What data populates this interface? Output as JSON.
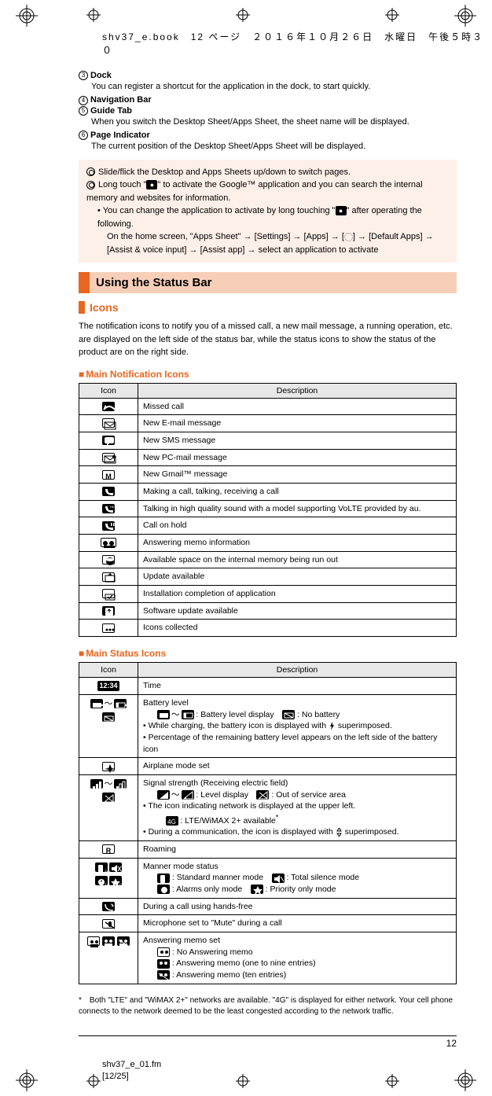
{
  "header": "shv37_e.book　12 ページ　２０１６年１０月２６日　水曜日　午後５時３０",
  "items": [
    {
      "num": "3",
      "title": "Dock",
      "desc": "You can register a shortcut for the application in the dock, to start quickly."
    },
    {
      "num": "4",
      "title": "Navigation Bar",
      "desc": ""
    },
    {
      "num": "5",
      "title": "Guide Tab",
      "desc": "When you switch the Desktop Sheet/Apps Sheet, the sheet name will be displayed."
    },
    {
      "num": "6",
      "title": "Page Indicator",
      "desc": "The current position of the Desktop Sheet/Apps Sheet will be displayed."
    }
  ],
  "note": {
    "l1": "Slide/flick the Desktop and Apps Sheets up/down to switch pages.",
    "l2a": "Long touch \"",
    "l2b": "\" to activate the Google™ application and you can search the internal memory and websites for information.",
    "s1a": "You can change the application to activate by long touching \"",
    "s1b": "\" after operating the following.",
    "s2": "On the home screen, \"Apps Sheet\" → [Settings] → [Apps] → [",
    "s2b": "] → [Default Apps] → [Assist & voice input] → [Assist app] → select an application to activate"
  },
  "section_title": "Using the Status Bar",
  "subsection_title": "Icons",
  "intro": "The notification icons to notify you of a missed call, a new mail message, a running operation, etc. are displayed on the left side of the status bar, while the status icons to show the status of the product are on the right side.",
  "table_headers": {
    "icon": "Icon",
    "desc": "Description"
  },
  "notif_heading": "Main Notification Icons",
  "notif_rows": [
    "Missed call",
    "New E-mail message",
    "New SMS message",
    "New PC-mail message",
    "New Gmail™ message",
    "Making a call, talking, receiving a call",
    "Talking in high quality sound with a model supporting VoLTE provided by au.",
    "Call on hold",
    "Answering memo information",
    "Available space on the internal memory being run out",
    "Update available",
    "Installation completion of application",
    "Software update available",
    "Icons collected"
  ],
  "status_heading": "Main Status Icons",
  "status": {
    "time_label": "12:34",
    "time": "Time",
    "battery": {
      "title": "Battery level",
      "l1": " : Battery level display　",
      "l1b": " : No battery",
      "l2": "While charging, the battery icon is displayed with ",
      "l2b": " superimposed.",
      "l3": "Percentage of the remaining battery level appears on the left side of the battery icon"
    },
    "airplane": "Airplane mode set",
    "signal": {
      "title": "Signal strength (Receiving electric field)",
      "l1": " : Level display　",
      "l1b": " : Out of service area",
      "l2": "The icon indicating network is displayed at the upper left.",
      "l2sub": " : LTE/WiMAX 2+ available",
      "l3": "During a communication, the icon is displayed with ",
      "l3b": " superimposed."
    },
    "roaming": "Roaming",
    "manner": {
      "title": "Manner mode status",
      "m1": " : Standard manner mode　",
      "m2": " : Total silence mode",
      "m3": " : Alarms only mode　",
      "m4": " : Priority only mode"
    },
    "handsfree": "During a call using hands-free",
    "mute": "Microphone set to \"Mute\" during a call",
    "memo": {
      "title": "Answering memo set",
      "m1": " : No Answering memo",
      "m2": " : Answering memo (one to nine entries)",
      "m3": " : Answering memo (ten entries)"
    }
  },
  "footnote_star": "*",
  "footnote": "Both \"LTE\" and \"WiMAX 2+\" networks are available. \"4G\" is displayed for either network. Your cell phone connects to the network deemed to be the least congested according to the network traffic.",
  "page_num": "12",
  "footer": {
    "l1": "shv37_e_01.fm",
    "l2": "[12/25]"
  }
}
